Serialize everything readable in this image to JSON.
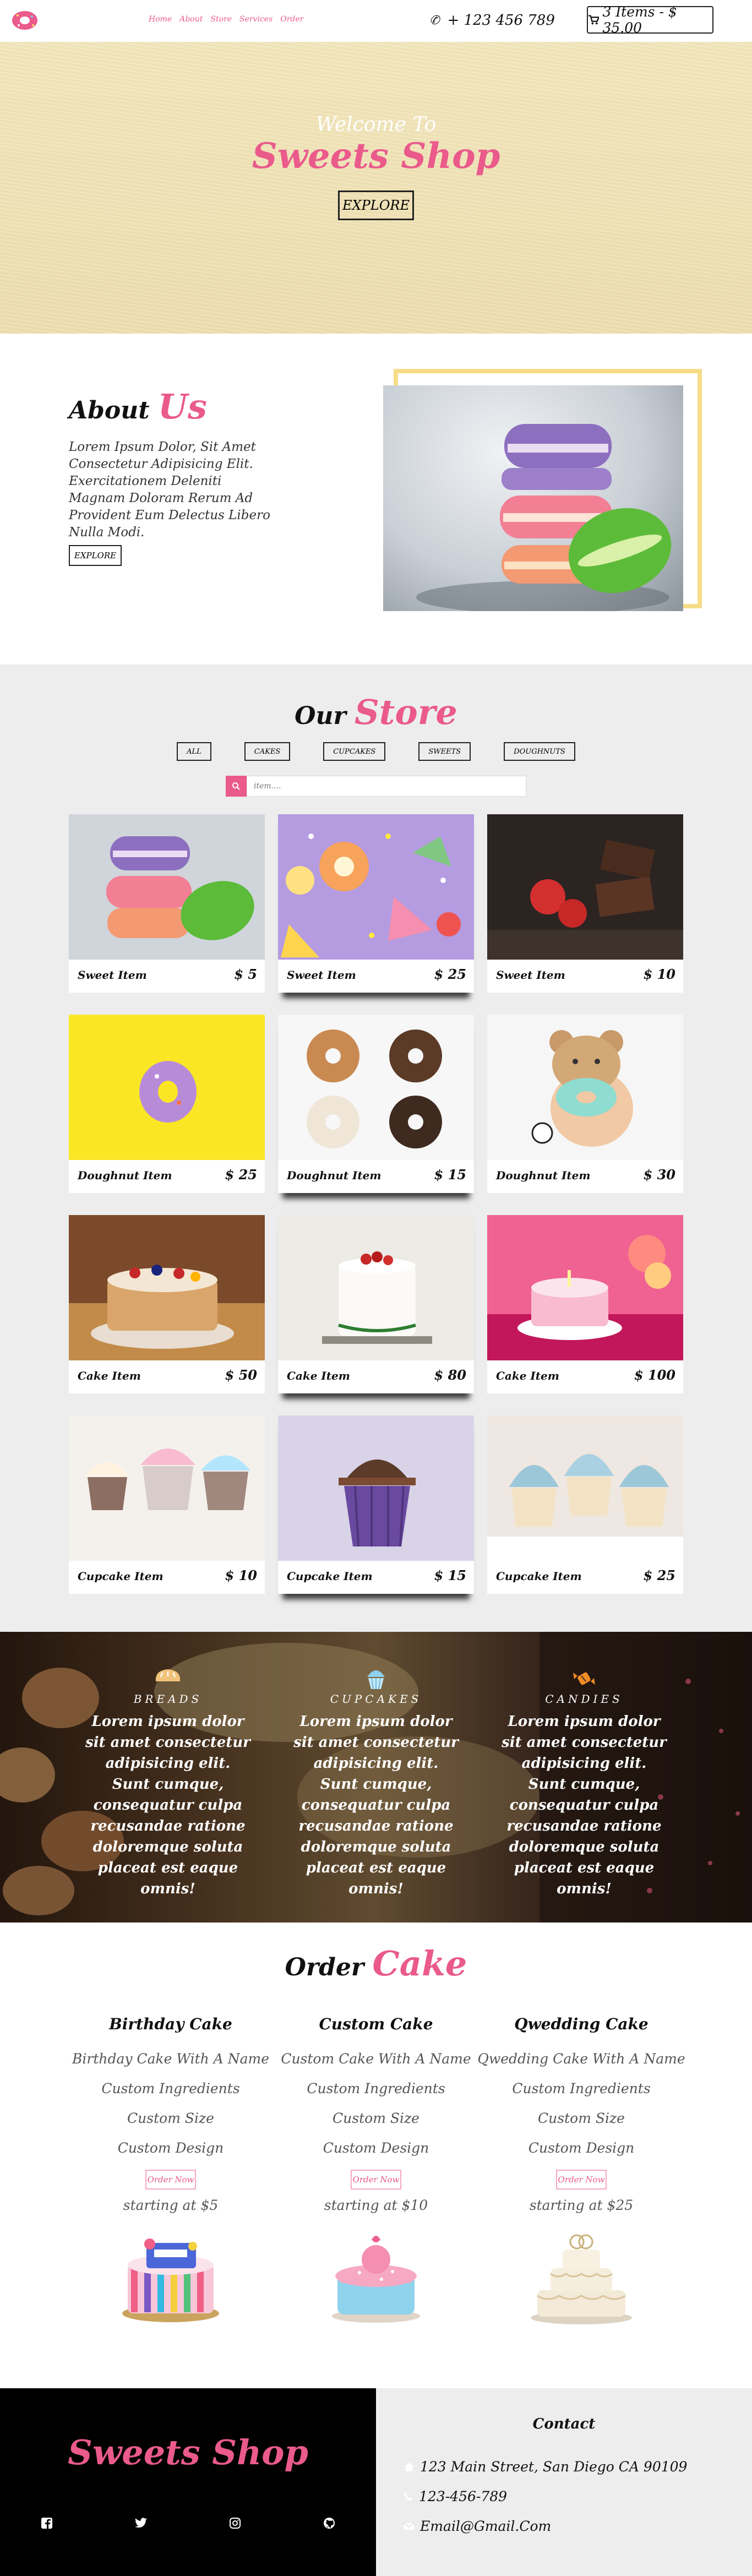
{
  "nav": {
    "links": [
      "Home",
      "About",
      "Store",
      "Services",
      "Order"
    ],
    "phone": "+ 123 456 789",
    "cart": "3 Items - $ 35.00"
  },
  "hero": {
    "welcome": "Welcome To",
    "title": "Sweets Shop",
    "button": "EXPLORE"
  },
  "about": {
    "title_1": "About",
    "title_2": "Us",
    "text": "Lorem Ipsum Dolor, Sit Amet Consectetur Adipisicing Elit. Exercitationem Deleniti Magnam Doloram Rerum Ad Provident Eum Delectus Libero Nulla Modi.",
    "button": "EXPLORE"
  },
  "store": {
    "title_1": "Our",
    "title_2": "Store",
    "filters": [
      "ALL",
      "CAKES",
      "CUPCAKES",
      "SWEETS",
      "DOUGHNUTS"
    ],
    "search_placeholder": "item....",
    "items": [
      {
        "name": "Sweet Item",
        "price": "$ 5",
        "kind": "macaron"
      },
      {
        "name": "Sweet Item",
        "price": "$ 25",
        "kind": "candy"
      },
      {
        "name": "Sweet Item",
        "price": "$ 10",
        "kind": "chocolate"
      },
      {
        "name": "Doughnut Item",
        "price": "$ 25",
        "kind": "donut-yellow"
      },
      {
        "name": "Doughnut Item",
        "price": "$ 15",
        "kind": "donut-box"
      },
      {
        "name": "Doughnut Item",
        "price": "$ 30",
        "kind": "donut-hand"
      },
      {
        "name": "Cake Item",
        "price": "$ 50",
        "kind": "cake-berry"
      },
      {
        "name": "Cake Item",
        "price": "$ 80",
        "kind": "cake-white"
      },
      {
        "name": "Cake Item",
        "price": "$ 100",
        "kind": "cake-pink"
      },
      {
        "name": "Cupcake Item",
        "price": "$ 10",
        "kind": "cupcake-row"
      },
      {
        "name": "Cupcake Item",
        "price": "$ 15",
        "kind": "cupcake-choc"
      },
      {
        "name": "Cupcake Item",
        "price": "$ 25",
        "kind": "cupcake-blue"
      }
    ]
  },
  "services": [
    {
      "title": "BREADS",
      "icon": "bread-icon",
      "text": "Lorem ipsum dolor sit amet consectetur adipisicing elit. Sunt cumque, consequatur culpa recusandae ratione doloremque soluta placeat est eaque omnis!"
    },
    {
      "title": "CUPCAKES",
      "icon": "cupcake-icon",
      "text": "Lorem ipsum dolor sit amet consectetur adipisicing elit. Sunt cumque, consequatur culpa recusandae ratione doloremque soluta placeat est eaque omnis!"
    },
    {
      "title": "CANDIES",
      "icon": "candy-icon",
      "text": "Lorem ipsum dolor sit amet consectetur adipisicing elit. Sunt cumque, consequatur culpa recusandae ratione doloremque soluta placeat est eaque omnis!"
    }
  ],
  "order": {
    "title_1": "Order",
    "title_2": "Cake",
    "columns": [
      {
        "heading": "Birthday Cake",
        "features": [
          "Birthday Cake With A Name",
          "Custom Ingredients",
          "Custom Size",
          "Custom Design"
        ],
        "button": "Order Now",
        "starting": "starting at $5"
      },
      {
        "heading": "Custom Cake",
        "features": [
          "Custom Cake With A Name",
          "Custom Ingredients",
          "Custom Size",
          "Custom Design"
        ],
        "button": "Order Now",
        "starting": "starting at $10"
      },
      {
        "heading": "Qwedding Cake",
        "features": [
          "Qwedding Cake With A Name",
          "Custom Ingredients",
          "Custom Size",
          "Custom Design"
        ],
        "button": "Order Now",
        "starting": "starting at $25"
      }
    ]
  },
  "footer": {
    "brand": "Sweets Shop",
    "social": [
      "facebook-icon",
      "twitter-icon",
      "instagram-icon",
      "github-icon"
    ],
    "contact_title": "Contact",
    "address": "123 Main Street, San Diego CA 90109",
    "phone": "123-456-789",
    "email": "Email@Gmail.Com"
  },
  "colors": {
    "accent": "#ea5a8b",
    "hero_bg": "#f0e2b6",
    "frame": "#f6dd88",
    "store_bg": "#ededed"
  }
}
